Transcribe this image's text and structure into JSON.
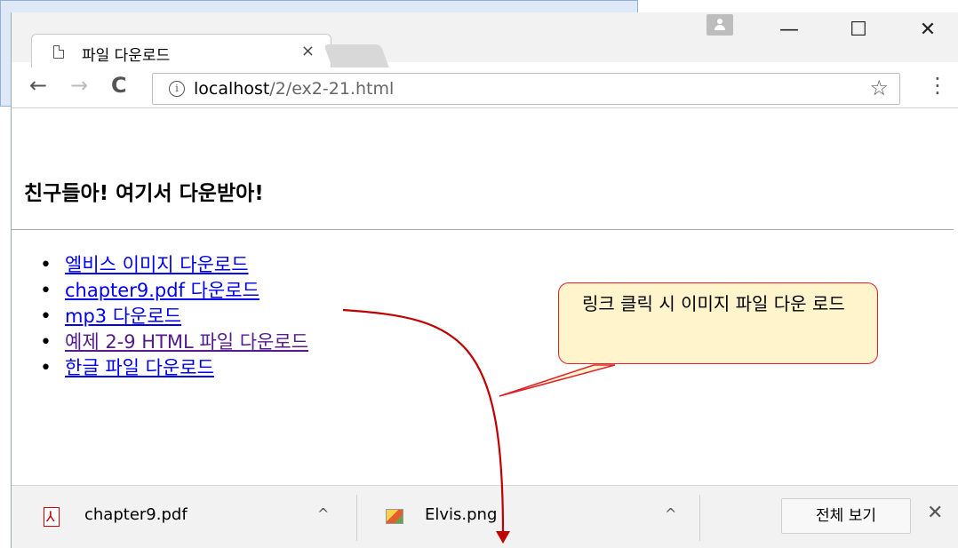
{
  "tab": {
    "title": "파일 다운로드",
    "close_glyph": "×"
  },
  "window_controls": {
    "minimize": "—",
    "maximize": "☐",
    "close": "✕"
  },
  "toolbar": {
    "back_glyph": "←",
    "forward_glyph": "→",
    "reload_glyph": "C",
    "url_host": "localhost",
    "url_path": "/2/ex2-21.html",
    "star_glyph": "☆",
    "menu_glyph": "⋮",
    "info_glyph": "i"
  },
  "page": {
    "heading": "친구들아! 여기서 다운받아!",
    "links": [
      {
        "label": "엘비스 이미지 다운로드",
        "visited": false
      },
      {
        "label": "chapter9.pdf 다운로드",
        "visited": false
      },
      {
        "label": "mp3 다운로드",
        "visited": false
      },
      {
        "label": "예제 2-9 HTML 파일 다운로드",
        "visited": true
      },
      {
        "label": "한글 파일 다운로드",
        "visited": false
      }
    ]
  },
  "callout": {
    "text": "링크 클릭 시 이미지 파일 다운 로드"
  },
  "download_bar": {
    "items": [
      {
        "name": "chapter9.pdf",
        "icon": "pdf-icon",
        "chevron": "^"
      },
      {
        "name": "Elvis.png",
        "icon": "image-icon",
        "chevron": "^"
      }
    ],
    "show_all_label": "전체 보기",
    "close_glyph": "✕"
  },
  "colors": {
    "link": "#0000ee",
    "visited": "#551a8b",
    "arrow": "#c00000",
    "callout_fill": "#fff4cc",
    "callout_border": "#e0202a"
  }
}
